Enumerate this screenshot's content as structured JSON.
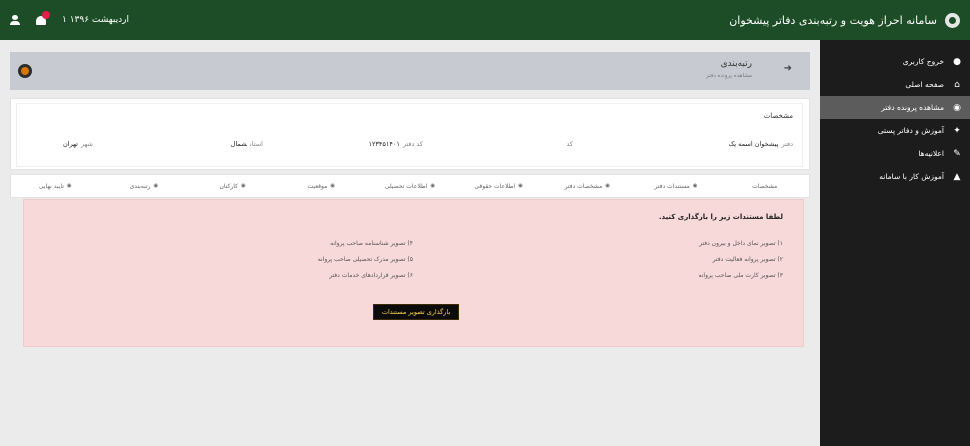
{
  "topbar": {
    "title": "سامانه احراز هویت و رتبه‌بندی دفاتر پیشخوان",
    "date": "۱ اردیبهشت ۱۳۹۶",
    "logo_icon": "seal-icon",
    "bell_icon": "bell-icon",
    "user_icon": "user-icon",
    "colors": {
      "header": "#1d4d27",
      "badge": "#e11d48"
    }
  },
  "sidebar": {
    "items": [
      {
        "label": "خروج کاربری",
        "icon": "user-icon",
        "active": false
      },
      {
        "label": "صفحه اصلی",
        "icon": "home-icon",
        "active": false
      },
      {
        "label": "مشاهده پرونده دفتر",
        "icon": "file-icon",
        "active": true
      },
      {
        "label": "آموزش و دفاتر پستی",
        "icon": "people-icon",
        "active": false
      },
      {
        "label": "اعلانیه‌ها",
        "icon": "pen-icon",
        "active": false
      },
      {
        "label": "آموزش کار با سامانه",
        "icon": "cap-icon",
        "active": false
      }
    ]
  },
  "page_header": {
    "title": "رتبه‌بندی",
    "subtitle": "مشاهده پرونده دفتر",
    "back_icon": "arrow-right-icon"
  },
  "info_card": {
    "title": "مشخصات",
    "fields": [
      {
        "label": "دفتر",
        "value": "پیشخوان اسمه یک"
      },
      {
        "label": "کد",
        "value": ""
      },
      {
        "label": "کد دفتر",
        "value": "۱۲۳۴۵۱۴۰۱"
      },
      {
        "label": "استان",
        "value": "شمال"
      },
      {
        "label": "شهر",
        "value": "تهران"
      }
    ]
  },
  "tabs": [
    {
      "label": "مشخصات",
      "icon": ""
    },
    {
      "label": "مستندات دفتر",
      "icon": "◉"
    },
    {
      "label": "مشخصات دفتر",
      "icon": "◉"
    },
    {
      "label": "اطلاعات حقوقی",
      "icon": "◉"
    },
    {
      "label": "اطلاعات تحصیلی",
      "icon": "◉"
    },
    {
      "label": "موقعیت",
      "icon": "◉"
    },
    {
      "label": "کارکنان",
      "icon": "◉"
    },
    {
      "label": "رتبه‌بندی",
      "icon": "◉"
    },
    {
      "label": "تایید نهایی",
      "icon": "◉"
    }
  ],
  "panel": {
    "heading": "لطفا مستندات زیر را بارگذاری کنید.",
    "docs_right": [
      "۱) تصویر نمای داخل و بیرون دفتر",
      "۲) تصویر پروانه فعالیت دفتر",
      "۳) تصویر کارت ملی صاحب پروانه"
    ],
    "docs_left": [
      "۴) تصویر شناسنامه صاحب پروانه",
      "۵) تصویر مدرک تحصیلی صاحب پروانه",
      "۶) تصویر قراردادهای خدمات دفتر"
    ],
    "upload_button": "بارگذاری تصویر مستندات",
    "colors": {
      "background": "#f7d9d9",
      "button": "#0b0b0b",
      "button_text": "#ffd54a"
    }
  }
}
